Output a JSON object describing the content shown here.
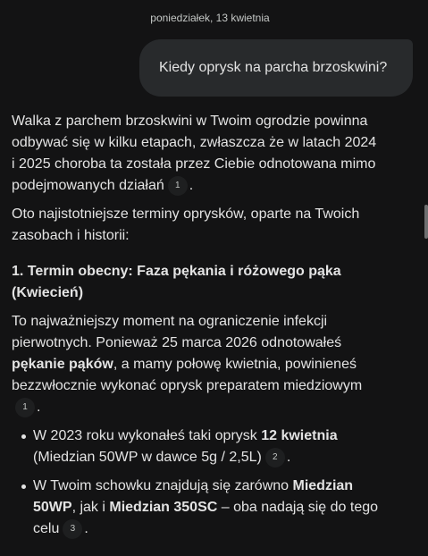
{
  "date_label": "poniedziałek, 13 kwietnia",
  "user_message": "Kiedy oprysk na parcha brzoskwini?",
  "answer": {
    "p1_text": "Walka z parchem brzoskwini w Twoim ogrodzie powinna odbywać się w kilku etapach, zwłaszcza że w latach 2024 i 2025 choroba ta została przez Ciebie odnotowana mimo podejmowanych działań",
    "p1_cite": "1",
    "p2_text": "Oto najistotniejsze terminy oprysków, oparte na Twoich zasobach i historii:",
    "h1": "1. Termin obecny: Faza pękania i różowego pąka (Kwiecień)",
    "p3_a": "To najważniejszy moment na ograniczenie infekcji pierwotnych. Ponieważ 25 marca 2026 odnotowałeś ",
    "p3_b": "pękanie pąków",
    "p3_c": ", a mamy połowę kwietnia, powinieneś bezzwłocznie wykonać oprysk preparatem miedziowym",
    "p3_cite": "1",
    "b1_a": "W 2023 roku wykonałeś taki oprysk ",
    "b1_b": "12 kwietnia",
    "b1_c": " (Miedzian 50WP w dawce 5g / 2,5L)",
    "b1_cite": "2",
    "b2_a": "W Twoim schowku znajdują się zarówno ",
    "b2_b": "Miedzian 50WP",
    "b2_c": ", jak i ",
    "b2_d": "Miedzian 350SC",
    "b2_e": " – oba nadają się do tego celu",
    "b2_cite": "3",
    "period": "."
  }
}
